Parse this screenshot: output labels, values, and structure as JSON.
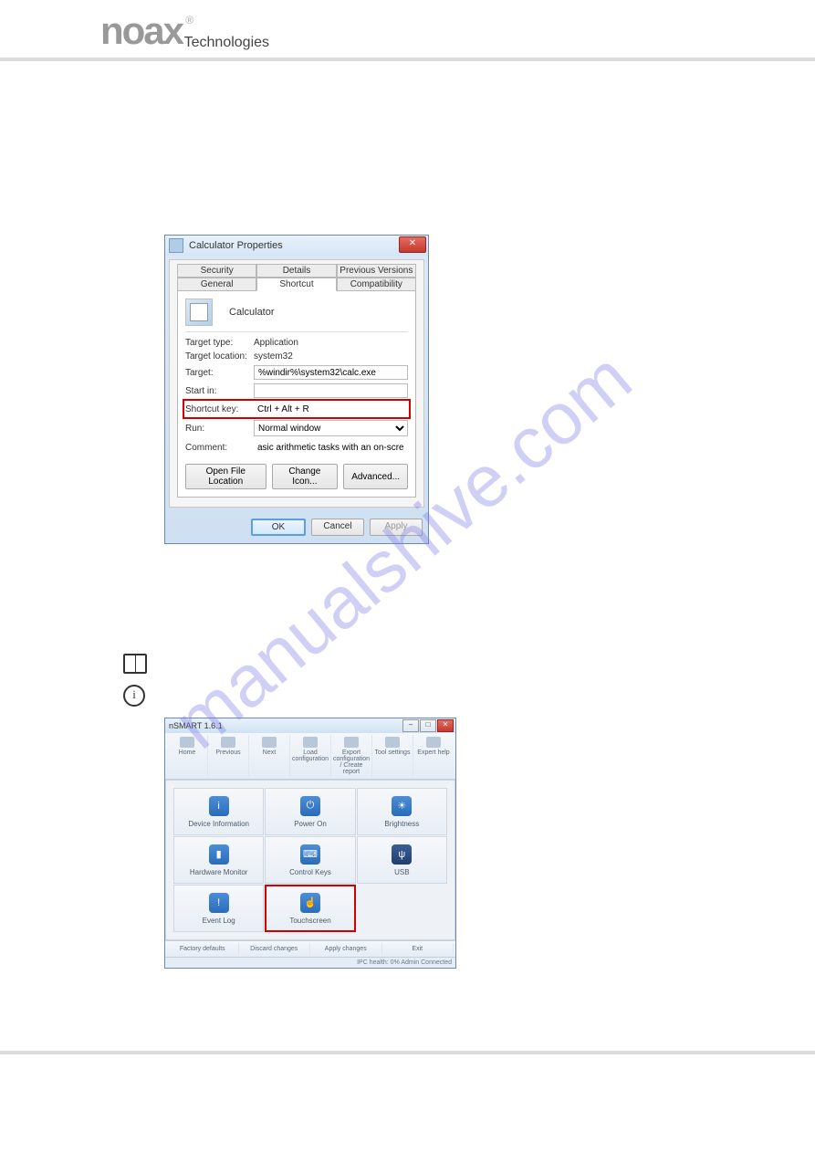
{
  "logo": {
    "brand": "noax",
    "sub": "Technologies",
    "reg": "®"
  },
  "watermark": "manualshive.com",
  "properties_dialog": {
    "title": "Calculator Properties",
    "tabs_row1": [
      "Security",
      "Details",
      "Previous Versions"
    ],
    "tabs_row2": [
      "General",
      "Shortcut",
      "Compatibility"
    ],
    "app_name": "Calculator",
    "target_type_label": "Target type:",
    "target_type_value": "Application",
    "target_location_label": "Target location:",
    "target_location_value": "system32",
    "target_label": "Target:",
    "target_value": "%windir%\\system32\\calc.exe",
    "startin_label": "Start in:",
    "startin_value": "",
    "shortcut_label": "Shortcut key:",
    "shortcut_value": "Ctrl + Alt + R",
    "run_label": "Run:",
    "run_value": "Normal window",
    "comment_label": "Comment:",
    "comment_value": "asic arithmetic tasks with an on-screen calculator.",
    "btn_open": "Open File Location",
    "btn_icon": "Change Icon...",
    "btn_adv": "Advanced...",
    "ok": "OK",
    "cancel": "Cancel",
    "apply": "Apply"
  },
  "nsmart": {
    "title": "nSMART 1.6.1",
    "toolbar": [
      "Home",
      "Previous",
      "Next",
      "Load configuration",
      "Export configuration / Create report",
      "Tool settings",
      "Expert help"
    ],
    "tiles": [
      "Device Information",
      "Power On",
      "Brightness",
      "Hardware Monitor",
      "Control Keys",
      "USB",
      "Event Log",
      "Touchscreen"
    ],
    "bottom": [
      "Factory defaults",
      "Discard changes",
      "Apply changes",
      "Exit"
    ],
    "status": "IPC health:    0%        Admin     Connected"
  }
}
